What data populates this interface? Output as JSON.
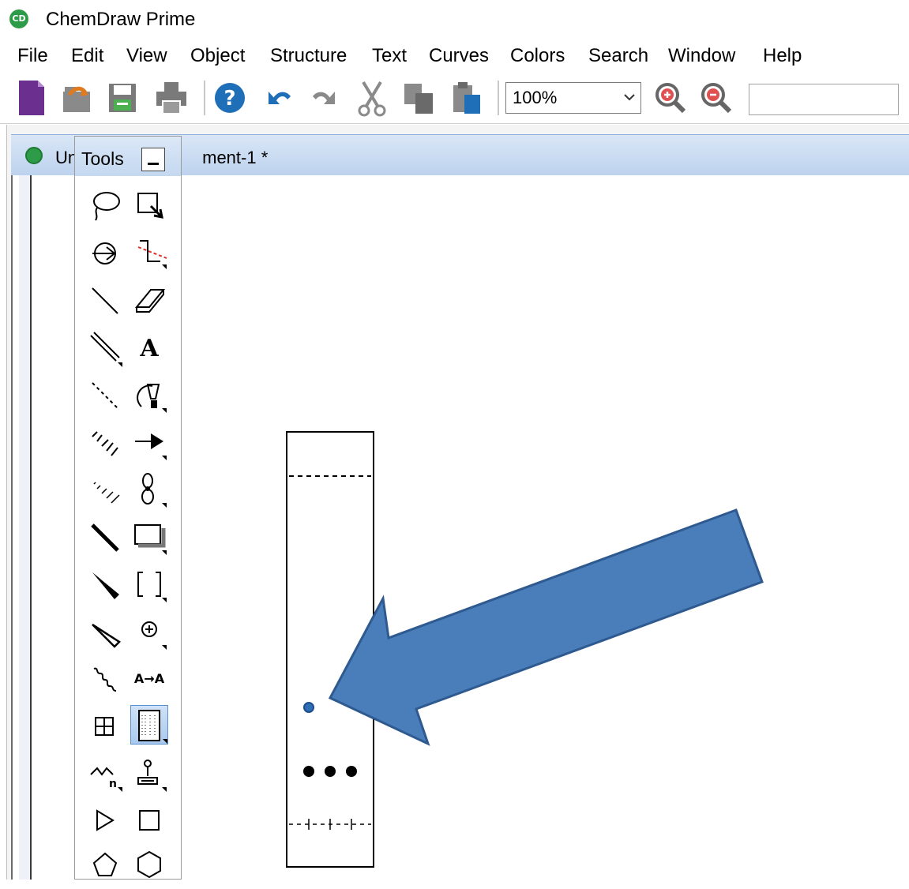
{
  "app": {
    "title": "ChemDraw Prime",
    "icon_text": "CD"
  },
  "menu": [
    {
      "label": "File"
    },
    {
      "label": "Edit"
    },
    {
      "label": "View"
    },
    {
      "label": "Object"
    },
    {
      "label": "Structure"
    },
    {
      "label": "Text"
    },
    {
      "label": "Curves"
    },
    {
      "label": "Colors"
    },
    {
      "label": "Search"
    },
    {
      "label": "Window"
    },
    {
      "label": "Help"
    }
  ],
  "toolbar": {
    "buttons": [
      {
        "icon": "new-document-icon"
      },
      {
        "icon": "open-icon"
      },
      {
        "icon": "save-icon"
      },
      {
        "icon": "print-icon"
      },
      {
        "icon": "help-icon"
      },
      {
        "icon": "undo-icon"
      },
      {
        "icon": "redo-icon"
      },
      {
        "icon": "cut-icon"
      },
      {
        "icon": "copy-icon"
      },
      {
        "icon": "paste-icon"
      },
      {
        "icon": "zoom-in-icon"
      },
      {
        "icon": "zoom-out-icon"
      }
    ],
    "zoom_value": "100%"
  },
  "document": {
    "title_visible_prefix": "Un",
    "title_visible_suffix": "ment-1 *"
  },
  "tools_palette": {
    "title": "Tools",
    "selected_tool": "tlc-plate-tool",
    "tools": [
      "lasso-icon",
      "marquee-icon",
      "structure-perspective-icon",
      "mass-fragmentation-icon",
      "solid-bond-icon",
      "eraser-icon",
      "multiple-bond-icon",
      "text-icon",
      "dashed-bond-icon",
      "pen-icon",
      "hashed-bond-icon",
      "arrow-icon",
      "hashed-wedge-bond-icon",
      "orbital-icon",
      "bold-bond-icon",
      "drawing-element-icon",
      "wedge-bond-icon",
      "bracket-icon",
      "hollow-wedge-bond-icon",
      "chemical-symbol-icon",
      "wavy-bond-icon",
      "atom-mapping-icon",
      "table-icon",
      "tlc-plate-icon",
      "query-icon",
      "template-icon",
      "triangle-icon",
      "square-icon",
      "pentagon-icon",
      "hexagon-icon"
    ],
    "atom_map_label": "A→A",
    "query_subscript": "n",
    "text_tool_label": "A"
  },
  "tlc_plate": {
    "solvent_front": "dashed",
    "spots_lane_count": 3,
    "selected_spot_color": "#2f6eb5"
  },
  "annotation": {
    "arrow_color": "#4a7ebb",
    "arrow_border": "#2e5a8f"
  }
}
